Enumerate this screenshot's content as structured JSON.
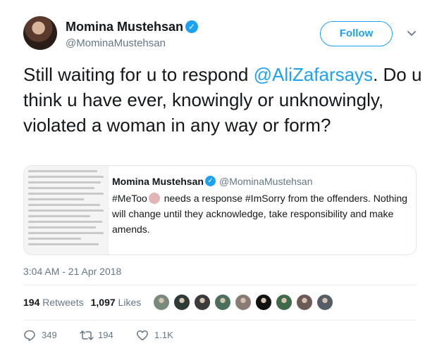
{
  "author": {
    "name": "Momina Mustehsan",
    "handle": "@MominaMustehsan",
    "follow_label": "Follow"
  },
  "tweet": {
    "text_before": "Still waiting for u to respond ",
    "mention": "@AliZafarsays",
    "text_after": ". Do u think u have ever, knowingly or unknowingly, violated a woman in any way or form?"
  },
  "quoted": {
    "name": "Momina Mustehsan",
    "handle": "@MominaMustehsan",
    "text_before": "#MeToo",
    "text_after": " needs a response #ImSorry from the offenders. Nothing will change until they acknowledge, take responsibility and make amends."
  },
  "timestamp": "3:04 AM - 21 Apr 2018",
  "stats": {
    "retweets_count": "194",
    "retweets_label": "Retweets",
    "likes_count": "1,097",
    "likes_label": "Likes"
  },
  "likers_colors": [
    "#7a8a7a",
    "#2d3a36",
    "#3b3b3b",
    "#4b6f5c",
    "#8a7a74",
    "#111111",
    "#3f6a4a",
    "#6b5a55",
    "#555d66"
  ],
  "actions": {
    "reply_count": "349",
    "retweet_count": "194",
    "like_count": "1.1K"
  },
  "colors": {
    "accent": "#1da1f2",
    "muted": "#657786"
  }
}
